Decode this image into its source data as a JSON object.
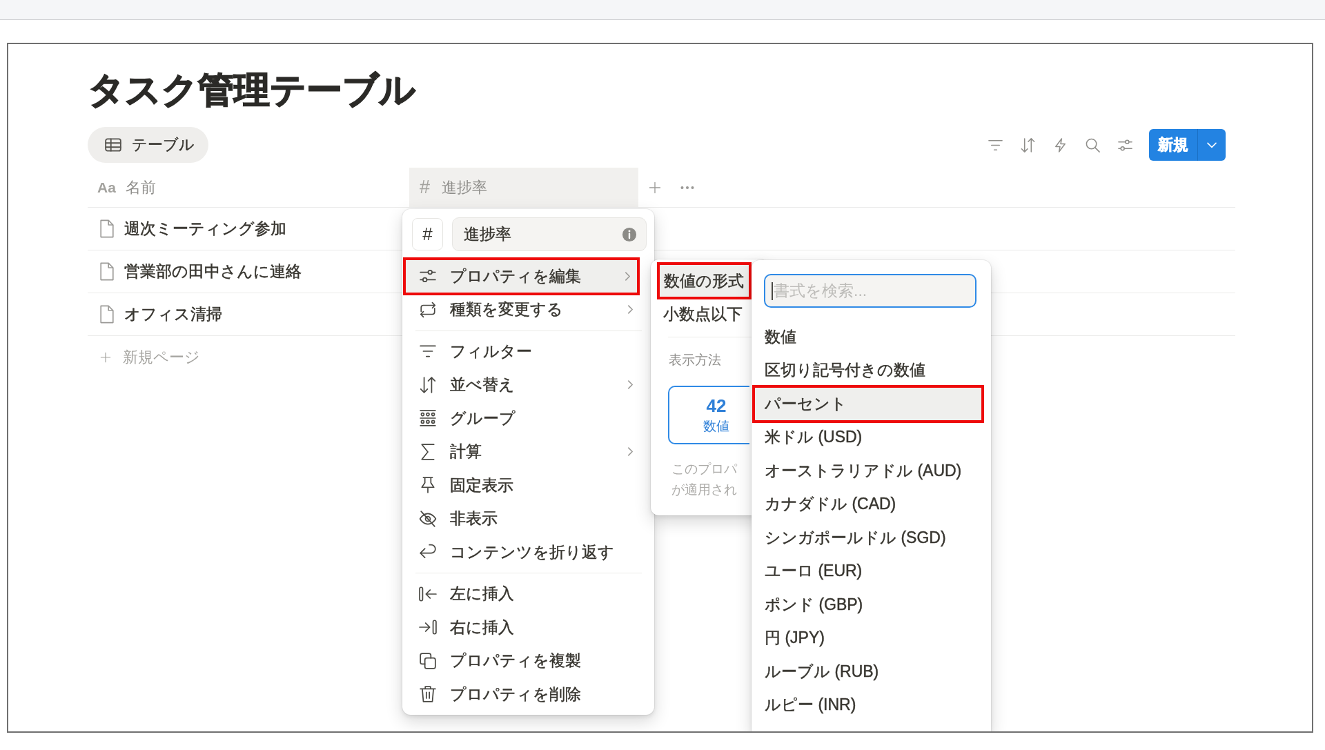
{
  "page_title": "タスク管理テーブル",
  "view_tabs": [
    {
      "label": "テーブル",
      "selected": true
    }
  ],
  "new_button": {
    "label": "新規"
  },
  "table": {
    "columns": [
      {
        "type_glyph": "Aa",
        "label": "名前",
        "selected": false
      },
      {
        "type_glyph": "#",
        "label": "進捗率",
        "selected": true
      }
    ],
    "rows": [
      {
        "name": "週次ミーティング参加"
      },
      {
        "name": "営業部の田中さんに連絡"
      },
      {
        "name": "オフィス清掃"
      }
    ],
    "new_row_label": "新規ページ"
  },
  "column_menu": {
    "type_glyph": "#",
    "name_value": "進捗率",
    "groups": [
      {
        "items": [
          {
            "label": "プロパティを編集",
            "submenu": true,
            "highlighted": true
          },
          {
            "label": "種類を変更する",
            "submenu": true,
            "highlighted": false
          }
        ]
      },
      {
        "items": [
          {
            "label": "フィルター",
            "submenu": false,
            "highlighted": false
          },
          {
            "label": "並べ替え",
            "submenu": true,
            "highlighted": false
          },
          {
            "label": "グループ",
            "submenu": false,
            "highlighted": false
          },
          {
            "label": "計算",
            "submenu": true,
            "highlighted": false
          },
          {
            "label": "固定表示",
            "submenu": false,
            "highlighted": false
          },
          {
            "label": "非表示",
            "submenu": false,
            "highlighted": false
          },
          {
            "label": "コンテンツを折り返す",
            "submenu": false,
            "highlighted": false
          }
        ]
      },
      {
        "items": [
          {
            "label": "左に挿入",
            "submenu": false,
            "highlighted": false
          },
          {
            "label": "右に挿入",
            "submenu": false,
            "highlighted": false
          },
          {
            "label": "プロパティを複製",
            "submenu": false,
            "highlighted": false
          },
          {
            "label": "プロパティを削除",
            "submenu": false,
            "highlighted": false
          }
        ]
      }
    ]
  },
  "property_panel": {
    "items": [
      {
        "label": "数値の形式",
        "highlighted": true
      },
      {
        "label": "小数点以下",
        "highlighted": false
      }
    ],
    "section_label": "表示方法",
    "display_options": [
      {
        "value": "42",
        "label": "数値",
        "selected": true
      }
    ],
    "description_lines": [
      "このプロパ",
      "が適用され"
    ]
  },
  "format_menu": {
    "search": {
      "placeholder": "書式を検索..."
    },
    "options": [
      {
        "label": "数値",
        "highlighted": false
      },
      {
        "label": "区切り記号付きの数値",
        "highlighted": false
      },
      {
        "label": "パーセント",
        "highlighted": true
      },
      {
        "label": "米ドル (USD)",
        "highlighted": false
      },
      {
        "label": "オーストラリアドル (AUD)",
        "highlighted": false
      },
      {
        "label": "カナダドル (CAD)",
        "highlighted": false
      },
      {
        "label": "シンガポールドル (SGD)",
        "highlighted": false
      },
      {
        "label": "ユーロ (EUR)",
        "highlighted": false
      },
      {
        "label": "ポンド (GBP)",
        "highlighted": false
      },
      {
        "label": "円 (JPY)",
        "highlighted": false
      },
      {
        "label": "ルーブル (RUB)",
        "highlighted": false
      },
      {
        "label": "ルピー (INR)",
        "highlighted": false
      }
    ]
  }
}
